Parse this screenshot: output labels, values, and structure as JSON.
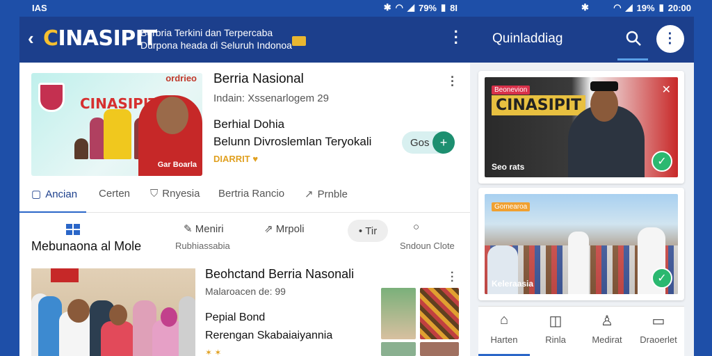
{
  "status_left": {
    "time": "IAS",
    "battery": "79%",
    "extra": "8I"
  },
  "status_right": {
    "battery": "19%",
    "time": "20:00"
  },
  "header": {
    "brand_mark": "C",
    "brand_rest": "INASIPIT",
    "tagline_line1": "Berbria Terkini dan Terpercaba",
    "tagline_line2": "Durpona heada di Seluruh Indonoa",
    "back_icon": "arrow-left-icon",
    "menu_icon": "kebab-menu-icon"
  },
  "featured": {
    "thumb_badge": "ordrieo",
    "thumb_brand": "CINASIPIT",
    "thumb_caption": "Gar Boarla",
    "title": "Berria Nasional",
    "meta": "Indain: Xssenarlogem 29",
    "line1": "Berhial Dohia",
    "line2": "Belunn Divroslemlan Teryokali",
    "tag": "DIARRIT",
    "action_label": "Gos",
    "action_icon": "plus-icon"
  },
  "tabs": [
    {
      "label": "Ancian",
      "icon": "square-icon"
    },
    {
      "label": "Certen",
      "icon": ""
    },
    {
      "label": "Rnyesia",
      "icon": "shield-icon"
    },
    {
      "label": "Bertria Rancio",
      "icon": ""
    },
    {
      "label": "Prnble",
      "icon": "trend-icon"
    }
  ],
  "categories": {
    "title": "Mebunaona al Mole",
    "items": [
      {
        "label": "Meniri",
        "sub": "Rubhiassabia",
        "icon": "pen-icon"
      },
      {
        "label": "Mrpoli",
        "icon": "share-icon"
      },
      {
        "label": "Tir",
        "icon": "dot-icon"
      },
      {
        "label": "Sndoun Clote",
        "icon": "pin-icon"
      }
    ]
  },
  "article2": {
    "title": "Beohctand Berria Nasonali",
    "meta": "Malaroacen de: 99",
    "line1": "Pepial Bond",
    "line2": "Rerengan Skabaiaiyannia",
    "stars": "✶ ✶"
  },
  "right_panel": {
    "title": "Quinladdiag",
    "search_icon": "search-icon",
    "menu_icon": "kebab-menu-icon",
    "cards": [
      {
        "badge": "Beonevion",
        "brand": "CINASIPIT",
        "caption": "Seo rats",
        "badge_color": "#d8314a"
      },
      {
        "badge": "Gomearoa",
        "caption": "Keleraasia",
        "badge_color": "#f0a030"
      }
    ],
    "nav": [
      {
        "label": "Harten",
        "icon": "home-icon"
      },
      {
        "label": "Rinla",
        "icon": "bookmark-icon"
      },
      {
        "label": "Medirat",
        "icon": "person-icon"
      },
      {
        "label": "Draoerlet",
        "icon": "tv-icon"
      }
    ]
  },
  "colors": {
    "primary": "#1c3f8c",
    "accent": "#2a66c8",
    "brand": "#f5c030",
    "success": "#2bb870"
  }
}
